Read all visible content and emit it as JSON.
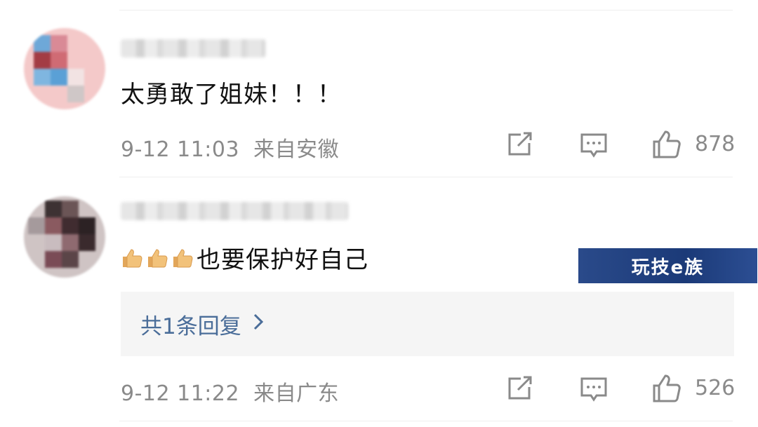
{
  "comments": [
    {
      "text": "太勇敢了姐妹！！！",
      "date": "9-12 11:03",
      "location": "来自安徽",
      "likes": "878"
    },
    {
      "text": "也要保护好自己",
      "date": "9-12 11:22",
      "location": "来自广东",
      "likes": "526",
      "replies_label": "共1条回复"
    }
  ],
  "watermark_text": "玩技e族",
  "colors": {
    "meta": "#8a8a8a",
    "link": "#4a6d99",
    "reply_bg": "#f5f5f5"
  },
  "icons": [
    "share-icon",
    "comment-icon",
    "like-icon",
    "chevron-right-icon",
    "thumbs-up-emoji"
  ]
}
